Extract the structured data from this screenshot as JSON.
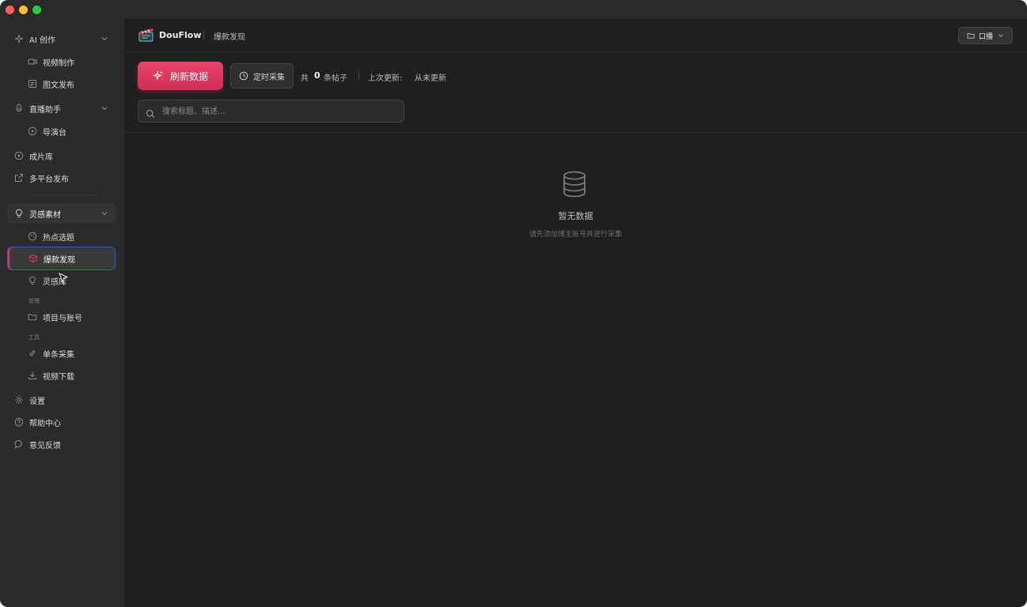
{
  "app": {
    "brand": "DouFlow",
    "breadcrumb": "爆款发现",
    "account_button": "口播"
  },
  "sidebar": {
    "ai_create": "AI 创作",
    "video_make": "视频制作",
    "image_post": "图文发布",
    "live_assistant": "直播助手",
    "director": "导演台",
    "library": "成片库",
    "multi_publish": "多平台发布",
    "inspiration": "灵感素材",
    "hot_topics": "热点选题",
    "viral_discovery": "爆款发现",
    "idea_library": "灵感库",
    "section_manage": "管理",
    "projects_accounts": "项目与账号",
    "section_tools": "工具",
    "single_collect": "单条采集",
    "video_download": "视频下载",
    "settings": "设置",
    "help": "帮助中心",
    "feedback": "意见反馈"
  },
  "toolbar": {
    "refresh_label": "刷新数据",
    "timer_label": "定时采集",
    "total_prefix": "共",
    "total_count": "0",
    "total_suffix": "条帖子",
    "last_update_label": "上次更新:",
    "last_update_value": "从未更新"
  },
  "search": {
    "placeholder": "搜索标题、描述..."
  },
  "empty_state": {
    "title": "暂无数据",
    "subtitle": "请先添加博主账号并进行采集"
  },
  "colors": {
    "accent": "#e0364f",
    "focus_ring": "#2f55d4",
    "background": "#1f1f1f",
    "sidebar": "#2b2b2b"
  }
}
